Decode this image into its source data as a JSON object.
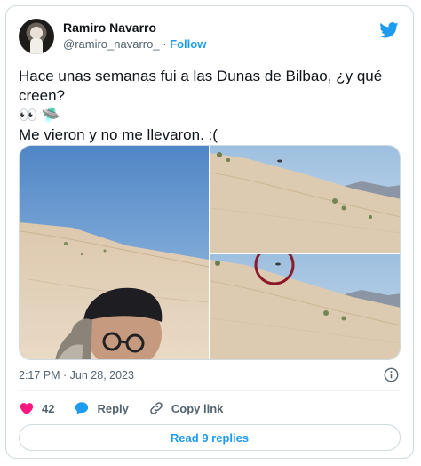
{
  "author": {
    "name": "Ramiro Navarro",
    "handle": "@ramiro_navarro_",
    "separator": "·",
    "follow_label": "Follow"
  },
  "tweet": {
    "line1": "Hace unas semanas fui a las Dunas de Bilbao, ¿y qué",
    "line2": "creen?",
    "emoji_eyes": "👀",
    "emoji_ufo": "🛸",
    "line3": "Me vieron y no me llevaron.  :("
  },
  "timestamp": "2:17 PM · Jun 28, 2023",
  "actions": {
    "like_count": "42",
    "reply_label": "Reply",
    "copy_link_label": "Copy link"
  },
  "read_replies_label": "Read 9 replies",
  "colors": {
    "brand_blue": "#1d9bf0",
    "like_red": "#f91880",
    "text_secondary": "#536471",
    "border": "#cfd9de",
    "highlight_circle": "#8b1a2b"
  },
  "icons": [
    "twitter-bird-icon",
    "info-icon",
    "heart-icon",
    "reply-bubble-icon",
    "link-icon"
  ]
}
